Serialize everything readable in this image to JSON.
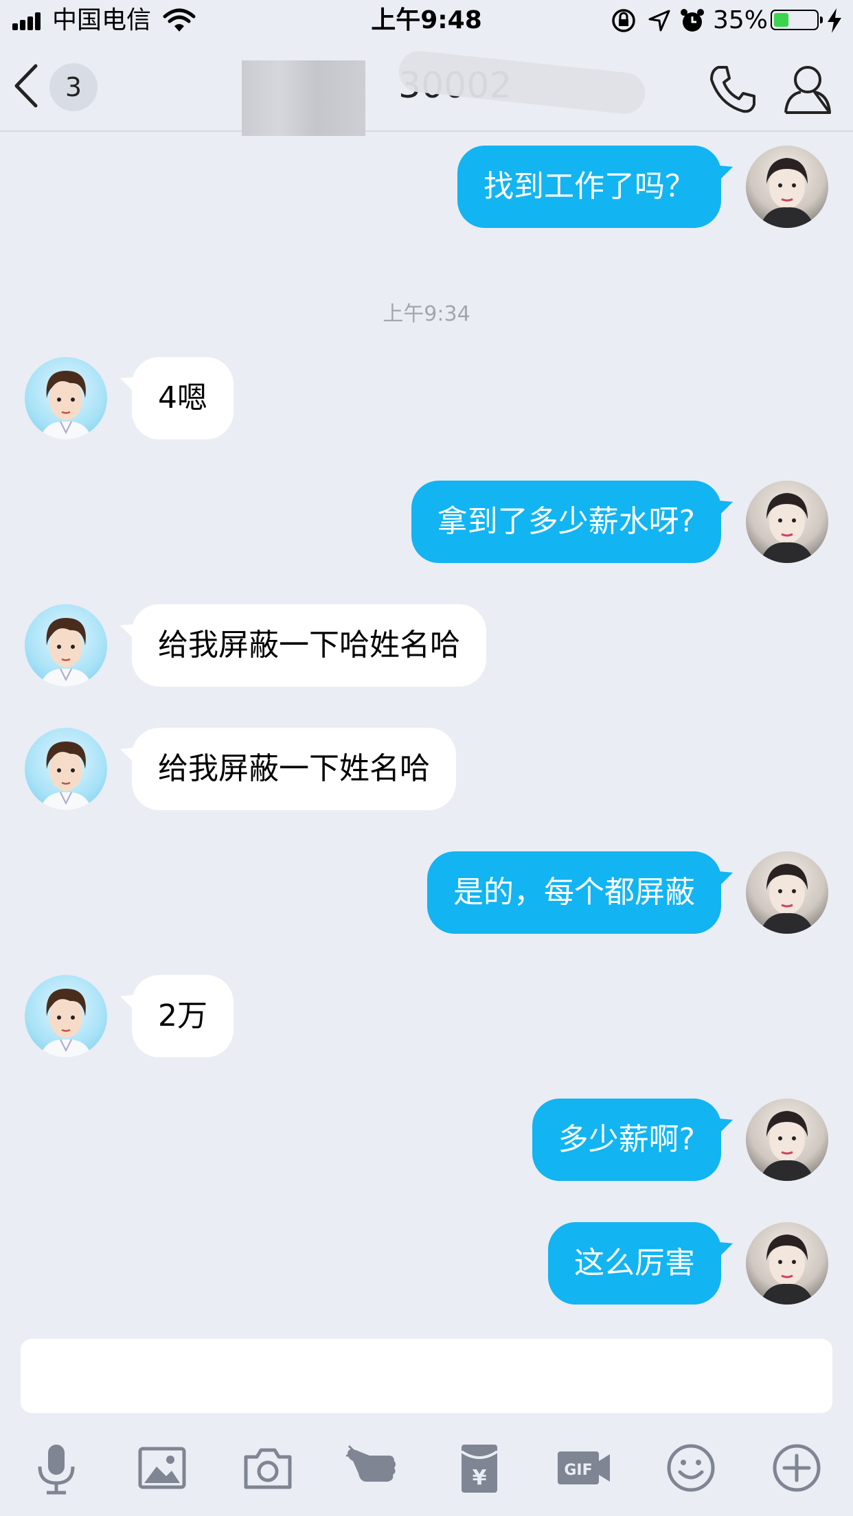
{
  "status_bar": {
    "carrier": "中国电信",
    "time": "上午9:48",
    "battery_percent": "35%",
    "battery_level": 0.35,
    "icons": [
      "signal-icon",
      "wifi-icon",
      "rotation-lock-icon",
      "location-icon",
      "alarm-icon",
      "battery-icon",
      "charging-icon"
    ]
  },
  "nav": {
    "back_icon": "chevron-left-icon",
    "unread_count": "3",
    "title": "30002",
    "call_icon": "phone-icon",
    "profile_icon": "person-icon"
  },
  "messages": [
    {
      "side": "me",
      "text": "找到工作了吗？"
    },
    {
      "side": "timestamp",
      "text": "上午9:34"
    },
    {
      "side": "other",
      "text": "4嗯"
    },
    {
      "side": "me",
      "text": "拿到了多少薪水呀?"
    },
    {
      "side": "other",
      "text": "给我屏蔽一下哈姓名哈"
    },
    {
      "side": "other",
      "text": "给我屏蔽一下姓名哈"
    },
    {
      "side": "me",
      "text": "是的，每个都屏蔽"
    },
    {
      "side": "other",
      "text": "2万"
    },
    {
      "side": "me",
      "text": "多少薪啊?"
    },
    {
      "side": "me",
      "text": "这么厉害"
    }
  ],
  "input": {
    "value": "",
    "placeholder": ""
  },
  "toolbar": [
    "microphone-icon",
    "image-icon",
    "camera-icon",
    "poke-hand-icon",
    "red-packet-icon",
    "gif-icon",
    "emoji-icon",
    "add-icon"
  ],
  "colors": {
    "background": "#eaedf4",
    "my_bubble": "#12b4f2",
    "other_bubble": "#ffffff",
    "icon_gray": "#7f8592"
  }
}
